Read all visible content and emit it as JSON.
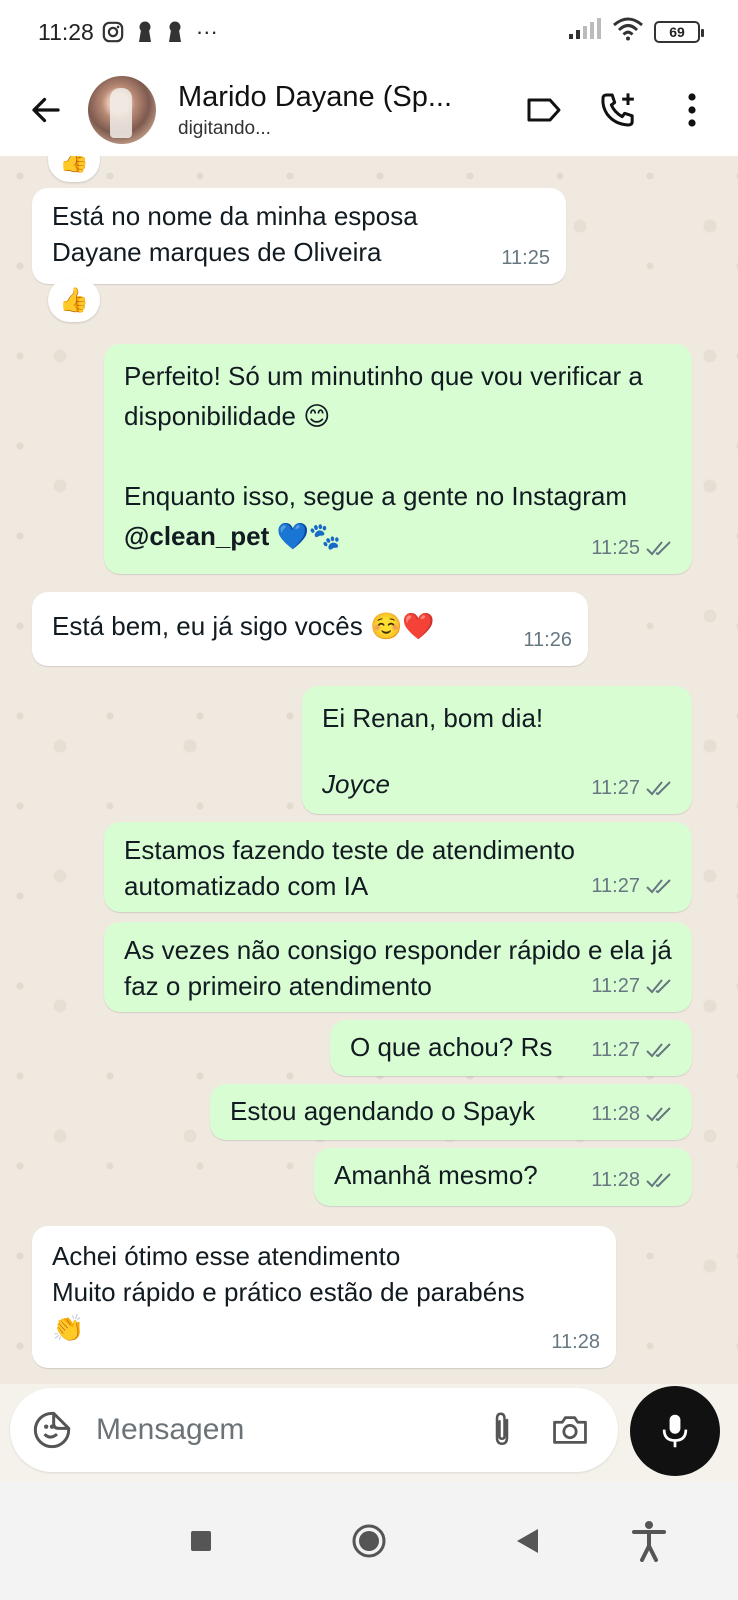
{
  "status_bar": {
    "time": "11:28",
    "battery": "69",
    "more": "···"
  },
  "header": {
    "contact_name": "Marido Dayane (Sp...",
    "contact_status": "digitando..."
  },
  "messages": [
    {
      "direction": "in",
      "text": "Está no nome da minha esposa\nDayane marques de Oliveira",
      "time": "11:25",
      "reaction": "👍"
    },
    {
      "direction": "out",
      "text": "Perfeito! Só um minutinho que vou verificar a disponibilidade 😊\n\nEnquanto isso, segue a gente no Instagram ",
      "handle": "@clean_pet",
      "text_end": " 💙🐾",
      "time": "11:25"
    },
    {
      "direction": "in",
      "text": "Está bem, eu já sigo vocês ☺️❤️",
      "time": "11:26"
    },
    {
      "direction": "out",
      "text": "Ei Renan, bom dia!",
      "signature": "Joyce",
      "time": "11:27"
    },
    {
      "direction": "out",
      "text": "Estamos fazendo teste de atendimento automatizado com IA",
      "time": "11:27"
    },
    {
      "direction": "out",
      "text": "As vezes não consigo responder rápido e ela já faz o primeiro atendimento",
      "time": "11:27"
    },
    {
      "direction": "out",
      "text": "O que achou? Rs",
      "time": "11:27"
    },
    {
      "direction": "out",
      "text": "Estou agendando o Spayk",
      "time": "11:28"
    },
    {
      "direction": "out",
      "text": "Amanhã mesmo?",
      "time": "11:28"
    },
    {
      "direction": "in",
      "text": "Achei ótimo esse atendimento\nMuito rápido e prático estão de parabéns\n👏",
      "time": "11:28"
    }
  ],
  "partial_reaction_top": "👍",
  "composer": {
    "placeholder": "Mensagem"
  },
  "colors": {
    "incoming_bubble": "#ffffff",
    "outgoing_bubble": "#d9fdd3",
    "chat_background": "#efe9e0",
    "time_text": "#667781"
  }
}
